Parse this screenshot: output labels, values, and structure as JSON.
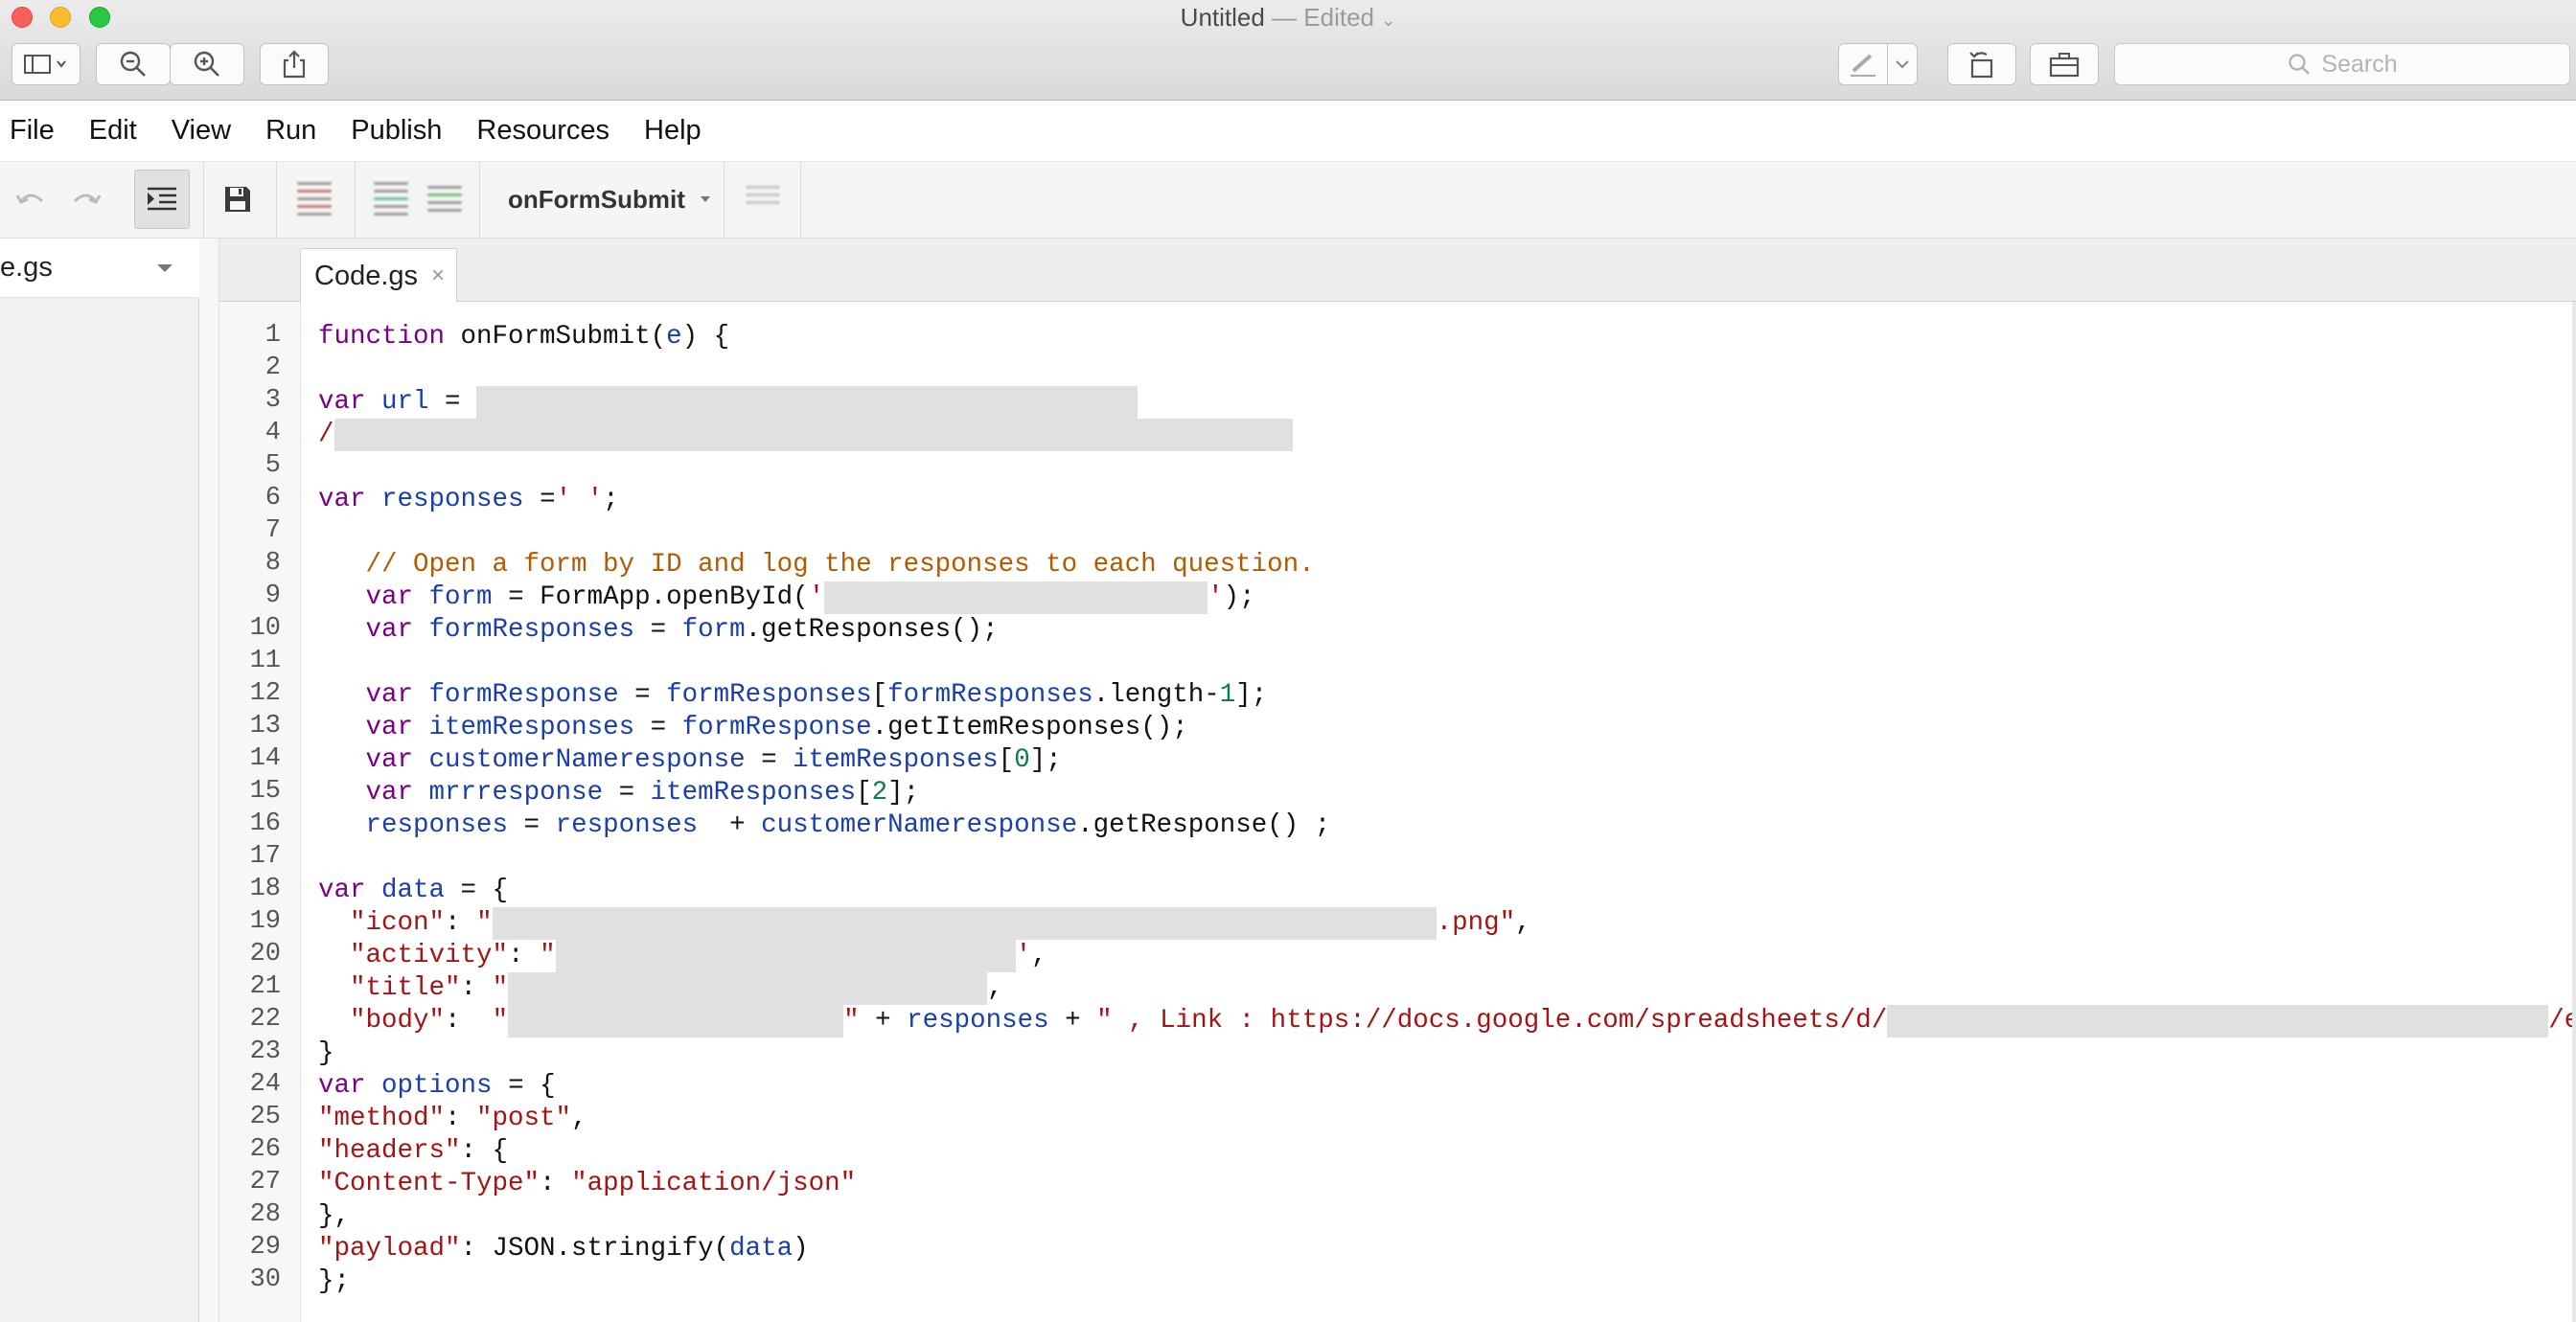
{
  "window": {
    "title": "Untitled",
    "edited_suffix": " — Edited"
  },
  "titlebar_tools": {
    "sidebar_icon": "sidebar-icon",
    "zoom_out_icon": "zoom-out-icon",
    "zoom_in_icon": "zoom-in-icon",
    "share_icon": "share-icon",
    "markup_icon": "pen-icon",
    "rotate_icon": "rotate-icon",
    "toolbox_icon": "toolbox-icon",
    "search_placeholder": "Search"
  },
  "menu": [
    "File",
    "Edit",
    "View",
    "Run",
    "Publish",
    "Resources",
    "Help"
  ],
  "toolbar": {
    "function_name": "onFormSubmit"
  },
  "filepanel": {
    "file_label": "e.gs"
  },
  "tab": {
    "label": "Code.gs",
    "close": "×"
  },
  "code": {
    "line_numbers": [
      "1",
      "2",
      "3",
      "4",
      "5",
      "6",
      "7",
      "8",
      "9",
      "10",
      "11",
      "12",
      "13",
      "14",
      "15",
      "16",
      "17",
      "18",
      "19",
      "20",
      "21",
      "22",
      "23",
      "24",
      "25",
      "26",
      "27",
      "28",
      "29",
      "30"
    ],
    "line1": {
      "kw": "function",
      "name": " onFormSubmit(",
      "param": "e",
      "rest": ") {"
    },
    "line3": {
      "kw": "var",
      "name": "url",
      "eq": " = "
    },
    "line4": {
      "slash": "/"
    },
    "line6": {
      "kw": "var",
      "name": "responses",
      "eq": " =",
      "str": "' '",
      "end": ";"
    },
    "line8": {
      "comment": "// Open a form by ID and log the responses to each question."
    },
    "line9": {
      "kw": "var",
      "name": "form",
      "eq": " = FormApp.openById(",
      "str1": "'",
      "str2": "'",
      "end": ");"
    },
    "line10": {
      "kw": "var",
      "name": "formResponses",
      "eq": " = ",
      "obj": "form",
      "end": ".getResponses();"
    },
    "line12": {
      "kw": "var",
      "name": "formResponse",
      "eq": " = ",
      "a": "formResponses",
      "b": "[",
      "c": "formResponses",
      "d": ".length-",
      "num": "1",
      "end": "];"
    },
    "line13": {
      "kw": "var",
      "name": "itemResponses",
      "eq": " = ",
      "obj": "formResponse",
      "end": ".getItemResponses();"
    },
    "line14": {
      "kw": "var",
      "name": "customerNameresponse",
      "eq": " = ",
      "obj": "itemResponses",
      "b": "[",
      "num": "0",
      "end": "];"
    },
    "line15": {
      "kw": "var",
      "name": "mrrresponse",
      "eq": " = ",
      "obj": "itemResponses",
      "b": "[",
      "num": "2",
      "end": "];"
    },
    "line16": {
      "a": "responses",
      "eq": " = ",
      "b": "responses",
      "plus": "  + ",
      "c": "customerNameresponse",
      "end": ".getResponse() ;"
    },
    "line18": {
      "kw": "var",
      "name": "data",
      "end": " = {"
    },
    "line19": {
      "key": "\"icon\"",
      "colon": ": ",
      "q": "\"",
      "tail": ".png\"",
      "comma": ","
    },
    "line20": {
      "key": "\"activity\"",
      "colon": ": ",
      "q": "\"",
      "tail": "'",
      "comma": ","
    },
    "line21": {
      "key": "\"title\"",
      "colon": ": ",
      "q": "\"",
      "comma": ","
    },
    "line22": {
      "key": "\"body\"",
      "colon": ":  ",
      "q": "\"",
      "q2": "\"",
      "plus": " + ",
      "resp": "responses",
      "plus2": " + ",
      "link": "\" , Link : https://docs.google.com/spreadsheets/d/",
      "tail": "/edi"
    },
    "line23": {
      "text": "}"
    },
    "line24": {
      "kw": "var",
      "name": "options",
      "end": " = {"
    },
    "line25": {
      "key": "\"method\"",
      "colon": ": ",
      "val": "\"post\"",
      "comma": ","
    },
    "line26": {
      "key": "\"headers\"",
      "end": ": {"
    },
    "line27": {
      "key": "\"Content-Type\"",
      "colon": ": ",
      "val": "\"application/json\""
    },
    "line28": {
      "text": "},"
    },
    "line29": {
      "key": "\"payload\"",
      "mid": ": JSON.stringify(",
      "arg": "data",
      "end": ")"
    },
    "line30": {
      "text": "};"
    }
  }
}
